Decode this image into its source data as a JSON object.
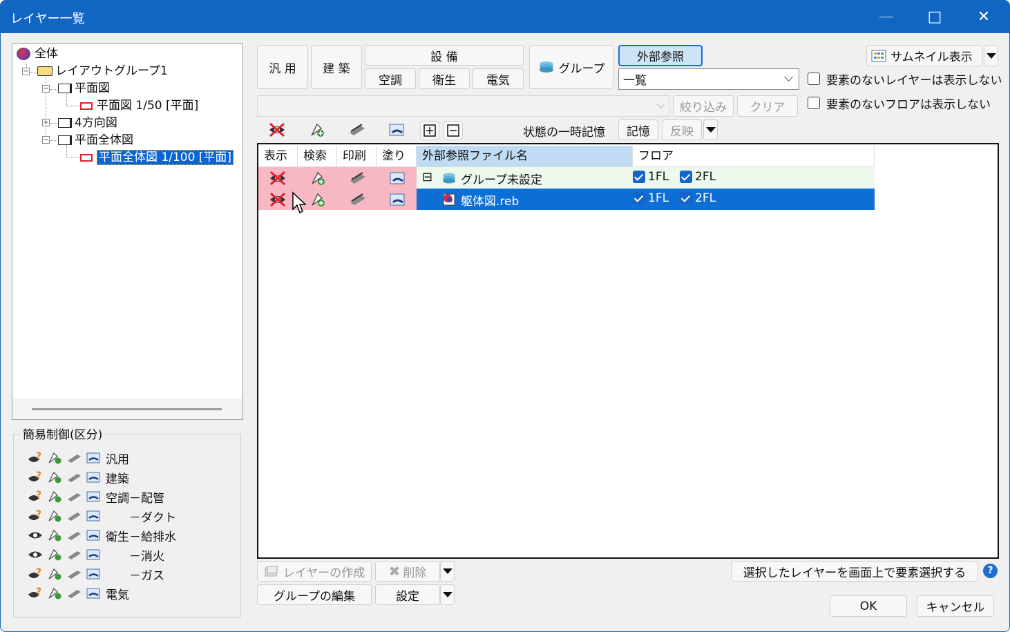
{
  "window": {
    "title": "レイヤー一覧"
  },
  "titlebar_buttons": {
    "minimize": "—",
    "maximize": "□",
    "close": "✕"
  },
  "tree": {
    "root": "全体",
    "layout_group": "レイアウトグループ1",
    "plan": "平面図",
    "plan_child": "平面図 1/50 [平面]",
    "four_dir": "4方向図",
    "plan_whole": "平面全体図",
    "plan_whole_child": "平面全体図 1/100 [平面]"
  },
  "simple_control": {
    "title": "簡易制御(区分)",
    "rows": [
      {
        "label": "汎用",
        "eye": false
      },
      {
        "label": "建築",
        "eye": false
      },
      {
        "label": "空調－配管",
        "eye": false
      },
      {
        "label": "　　－ダクト",
        "eye": false
      },
      {
        "label": "衛生－給排水",
        "eye": true
      },
      {
        "label": "　　－消火",
        "eye": true
      },
      {
        "label": "　　－ガス",
        "eye": false
      },
      {
        "label": "電気",
        "eye": false
      }
    ]
  },
  "category_buttons": {
    "general": "汎 用",
    "architecture": "建 築",
    "equipment": "設 備",
    "hvac": "空調",
    "sanitary": "衛生",
    "electric": "電気",
    "group": "グループ",
    "external_ref": "外部参照"
  },
  "view_select": {
    "value": "一覧"
  },
  "filter": {
    "placeholder": "",
    "narrow": "絞り込み",
    "clear": "クリア"
  },
  "thumbnail": {
    "label": "サムネイル表示"
  },
  "options": {
    "hide_empty_layers": "要素のないレイヤーは表示しない",
    "hide_empty_floors": "要素のないフロアは表示しない"
  },
  "state_memory": {
    "label": "状態の一時記憶",
    "store": "記憶",
    "apply": "反映"
  },
  "grid": {
    "headers": [
      "表示",
      "検索",
      "印刷",
      "塗り",
      "外部参照ファイル名",
      "フロア"
    ],
    "rows": [
      {
        "expander": "⊟",
        "name": "グループ未設定",
        "floors": [
          "1FL",
          "2FL"
        ],
        "selected": false
      },
      {
        "expander": "",
        "name": "躯体図.reb",
        "floors": [
          "1FL",
          "2FL"
        ],
        "selected": true
      }
    ]
  },
  "bottom": {
    "create_layer": "レイヤーの作成",
    "delete": "削除",
    "edit_group": "グループの編集",
    "settings": "設定",
    "select_on_screen": "選択したレイヤーを画面上で要素選択する",
    "help": "?",
    "ok": "OK",
    "cancel": "キャンセル"
  }
}
